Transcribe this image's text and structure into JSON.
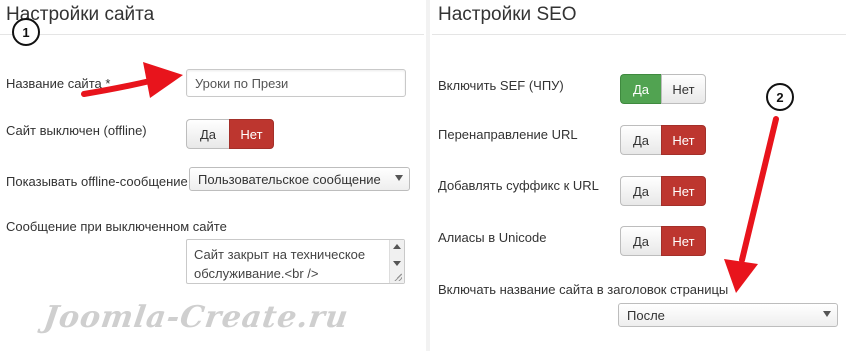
{
  "site_settings": {
    "title": "Настройки сайта",
    "site_name_label": "Название сайта *",
    "site_name_value": "Уроки по Прези",
    "offline_label": "Сайт выключен (offline)",
    "offline_yes": "Да",
    "offline_no": "Нет",
    "offline_selected": "no",
    "show_offline_msg_label": "Показывать offline-сообщение",
    "show_offline_msg_value": "Пользовательское сообщение",
    "offline_msg_label": "Сообщение при выключенном сайте",
    "offline_msg_line1": "Сайт закрыт на техническое",
    "offline_msg_line2": "обслуживание.<br />"
  },
  "seo_settings": {
    "title": "Настройки SEO",
    "sef_label": "Включить SEF (ЧПУ)",
    "sef_yes": "Да",
    "sef_no": "Нет",
    "sef_selected": "yes",
    "rewrite_label": "Перенаправление URL",
    "rewrite_yes": "Да",
    "rewrite_no": "Нет",
    "rewrite_selected": "no",
    "suffix_label": "Добавлять суффикс к URL",
    "suffix_yes": "Да",
    "suffix_no": "Нет",
    "suffix_selected": "no",
    "unicode_label": "Алиасы в Unicode",
    "unicode_yes": "Да",
    "unicode_no": "Нет",
    "unicode_selected": "no",
    "sitename_pagetitle_label": "Включать название сайта в заголовок страницы",
    "sitename_pagetitle_value": "После"
  },
  "annotations": {
    "callout_1": "1",
    "callout_2": "2",
    "arrow_color": "#e8141c"
  },
  "watermark": "Joomla-Create.ru",
  "colors": {
    "toggle_on_red": "#bd362f",
    "toggle_on_green": "#51a351"
  }
}
